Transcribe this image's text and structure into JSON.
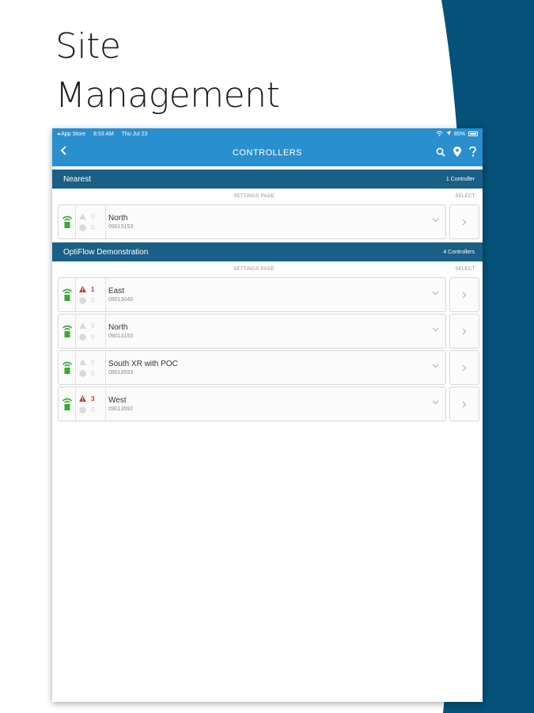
{
  "colors": {
    "brand": "#2a8fcf",
    "section": "#1a5f85",
    "wave": "#045179",
    "alert": "#d32f2f",
    "signal": "#3aa935"
  },
  "headline": {
    "line1": "Site",
    "line2": "Management"
  },
  "status_bar": {
    "carrier": "◂ App Store",
    "time": "8:53 AM",
    "date": "Thu Jul 23",
    "battery": "85%"
  },
  "nav": {
    "title": "CONTROLLERS",
    "back_icon": "chevron-left-icon",
    "icons": [
      "search-icon",
      "location-pin-icon",
      "help-icon"
    ]
  },
  "sections": [
    {
      "title": "Nearest",
      "count": "1 Controller",
      "col_settings": "SETTINGS PAGE",
      "col_select": "SELECT",
      "controllers": [
        {
          "name": "North",
          "serial": "09013153",
          "alarms": "0",
          "alarm_active": false,
          "offline": "0"
        }
      ]
    },
    {
      "title": "OptiFlow Demonstration",
      "count": "4 Controllers",
      "col_settings": "SETTINGS PAGE",
      "col_select": "SELECT",
      "controllers": [
        {
          "name": "East",
          "serial": "09013040",
          "alarms": "1",
          "alarm_active": true,
          "offline": "0"
        },
        {
          "name": "North",
          "serial": "09013153",
          "alarms": "0",
          "alarm_active": false,
          "offline": "0"
        },
        {
          "name": "South XR with POC",
          "serial": "09013593",
          "alarms": "0",
          "alarm_active": false,
          "offline": "0"
        },
        {
          "name": "West",
          "serial": "09013592",
          "alarms": "3",
          "alarm_active": true,
          "offline": "0"
        }
      ]
    }
  ]
}
